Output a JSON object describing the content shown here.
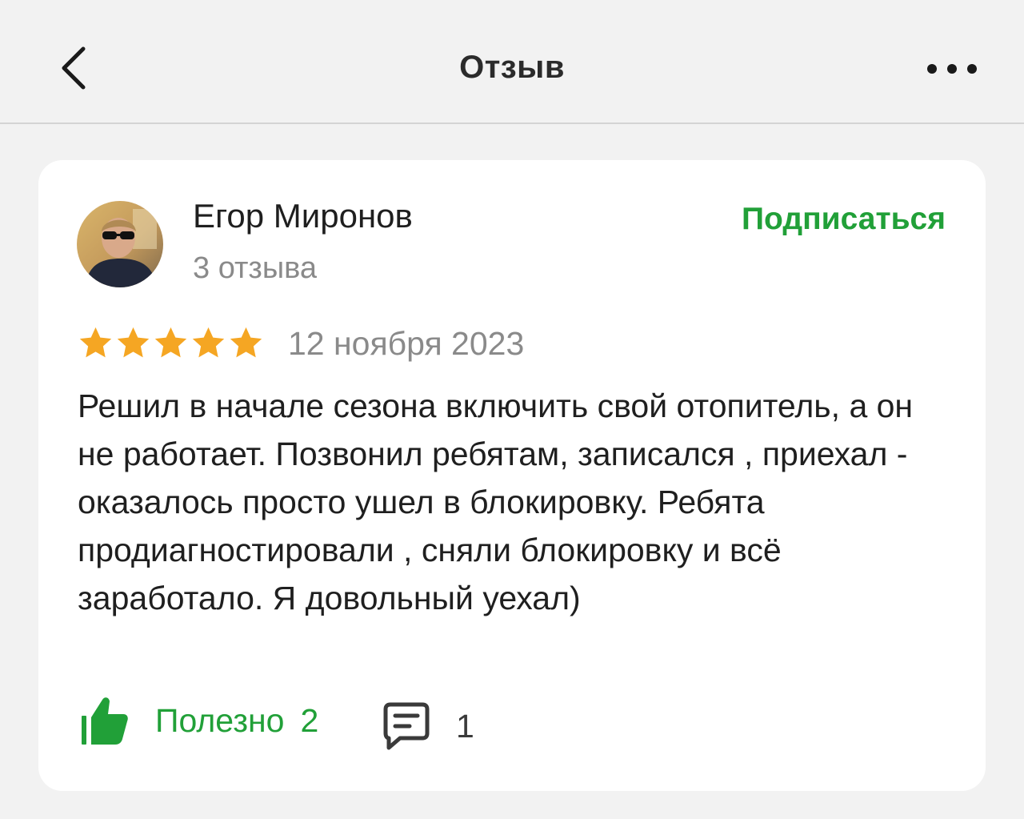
{
  "header": {
    "title": "Отзыв",
    "back_icon": "chevron-left-icon",
    "more_icon": "more-horizontal-icon"
  },
  "review": {
    "author": {
      "name": "Егор Миронов",
      "reviews_count": "3 отзыва"
    },
    "subscribe_label": "Подписаться",
    "rating": 5,
    "date": "12 ноября 2023",
    "text": "Решил в начале сезона включить свой отопитель, а он не работает. Позвонил ребятам, записался , приехал - оказалось просто ушел в блокировку. Ребята продиагностировали , сняли блокировку и всё заработало. Я довольный уехал)",
    "useful_label": "Полезно",
    "useful_count": "2",
    "comments_count": "1"
  },
  "colors": {
    "accent": "#21a038",
    "star": "#f5a623",
    "background": "#f2f2f2",
    "card": "#ffffff",
    "muted_text": "#8a8a8a"
  }
}
